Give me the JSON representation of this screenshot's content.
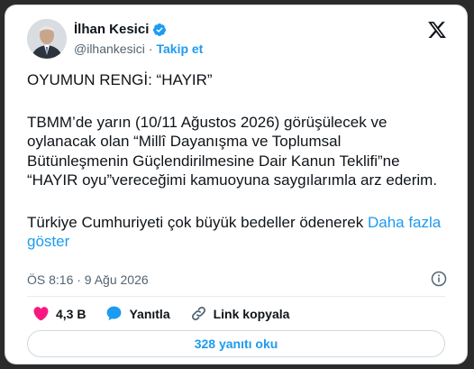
{
  "author": {
    "name": "İlhan Kesici",
    "handle": "@ilhankesici",
    "separator": "·",
    "follow_label": "Takip et"
  },
  "tweet": {
    "paragraphs": [
      "OYUMUN RENGİ: “HAYIR”",
      "TBMM’de yarın (10/11 Ağustos 2026) görüşülecek ve oylanacak olan “Millî Dayanışma ve Toplumsal Bütünleşmenin Güçlendirilmesine Dair Kanun Teklifi”ne “HAYIR oyu”vereceğimi kamuoyuna saygılarımla arz ederim.",
      "Türkiye Cumhuriyeti çok büyük bedeller ödenerek "
    ],
    "show_more": "Daha fazla göster",
    "timestamp": "ÖS 8:16 · 9 Ağu 2026"
  },
  "actions": {
    "likes": "4,3 B",
    "reply_label": "Yanıtla",
    "copy_link_label": "Link kopyala"
  },
  "replies_button": "328 yanıtı oku",
  "colors": {
    "accent": "#1d9bf0",
    "like": "#f91880",
    "text": "#0f1419",
    "muted": "#536471"
  },
  "icons": [
    "verified-icon",
    "x-logo-icon",
    "info-icon",
    "heart-icon",
    "reply-icon",
    "link-icon"
  ]
}
